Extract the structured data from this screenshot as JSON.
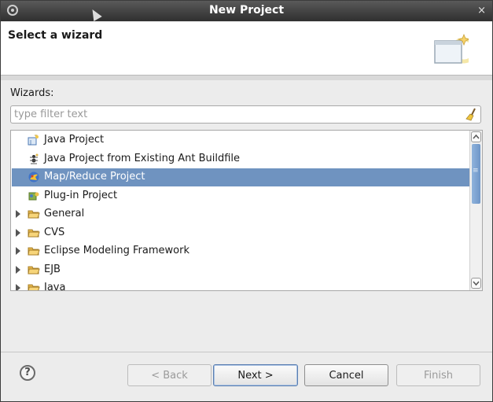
{
  "window": {
    "title": "New Project",
    "close_glyph": "×"
  },
  "banner": {
    "heading": "Select a wizard",
    "icon": "wizard-banner-icon"
  },
  "wizards_label": "Wizards:",
  "filter": {
    "placeholder": "type filter text",
    "value": "",
    "clear_icon": "broom-icon"
  },
  "tree": {
    "items": [
      {
        "label": "Java Project",
        "icon": "java-project-icon",
        "expandable": false,
        "selected": false
      },
      {
        "label": "Java Project from Existing Ant Buildfile",
        "icon": "ant-icon",
        "expandable": false,
        "selected": false
      },
      {
        "label": "Map/Reduce Project",
        "icon": "mapreduce-icon",
        "expandable": false,
        "selected": true
      },
      {
        "label": "Plug-in Project",
        "icon": "plugin-icon",
        "expandable": false,
        "selected": false
      },
      {
        "label": "General",
        "icon": "folder-icon",
        "expandable": true,
        "selected": false
      },
      {
        "label": "CVS",
        "icon": "folder-icon",
        "expandable": true,
        "selected": false
      },
      {
        "label": "Eclipse Modeling Framework",
        "icon": "folder-icon",
        "expandable": true,
        "selected": false
      },
      {
        "label": "EJB",
        "icon": "folder-icon",
        "expandable": true,
        "selected": false
      },
      {
        "label": "Java",
        "icon": "folder-icon",
        "expandable": true,
        "selected": false
      }
    ]
  },
  "buttons": {
    "back": "< Back",
    "next": "Next >",
    "cancel": "Cancel",
    "finish": "Finish"
  },
  "colors": {
    "selection": "#6f93c0",
    "folder": "#e8b84a"
  }
}
